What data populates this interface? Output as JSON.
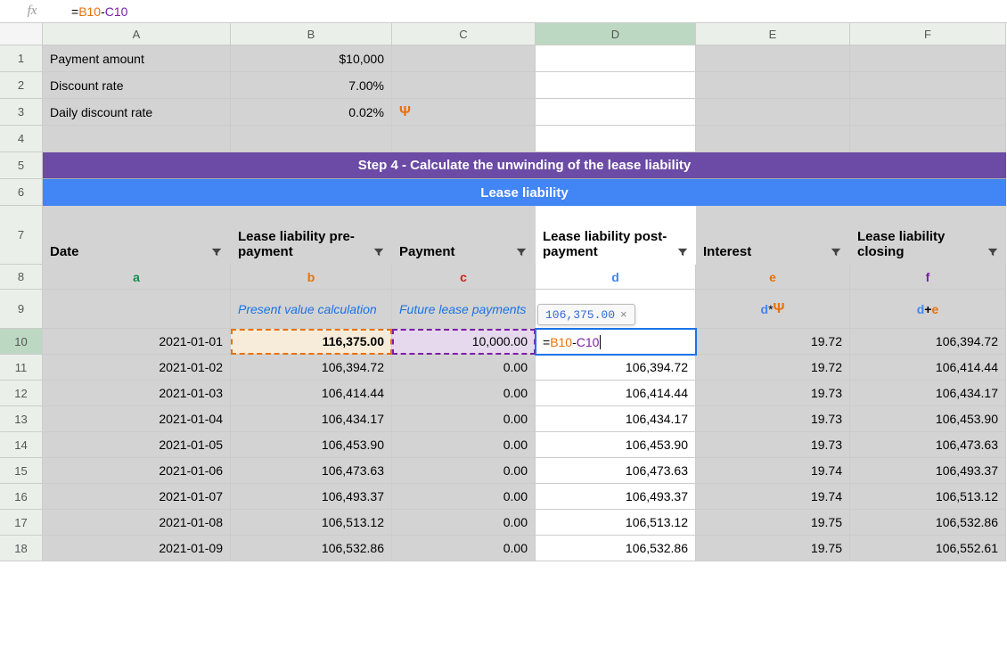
{
  "formula_bar": {
    "fx": "fx",
    "eq": "=",
    "ref_b": "B10",
    "minus": "-",
    "ref_c": "C10"
  },
  "columns": [
    "A",
    "B",
    "C",
    "D",
    "E",
    "F"
  ],
  "row_nums": [
    "1",
    "2",
    "3",
    "4",
    "5",
    "6",
    "7",
    "8",
    "9",
    "10",
    "11",
    "12",
    "13",
    "14",
    "15",
    "16",
    "17",
    "18"
  ],
  "params": {
    "a1": "Payment amount",
    "b1": "$10,000",
    "a2": "Discount rate",
    "b2": "7.00%",
    "a3": "Daily discount rate",
    "b3": "0.02%",
    "c3": "Ψ"
  },
  "titles": {
    "step": "Step 4 - Calculate the unwinding of the lease liability",
    "lease": "Lease liability"
  },
  "headers": {
    "a": "Date",
    "b": "Lease liability pre-payment",
    "c": "Payment",
    "d": "Lease liability post-payment",
    "e": "Interest",
    "f": "Lease liability closing"
  },
  "letters": {
    "a": "a",
    "b": "b",
    "c": "c",
    "d": "d",
    "e": "e",
    "f": "f"
  },
  "row9": {
    "b": "Present value calculation",
    "c": "Future lease payments",
    "e_d": "d",
    "e_star": " * ",
    "e_psi": "Ψ",
    "f_d": "d",
    "f_plus": " + ",
    "f_e": "e"
  },
  "d10_edit": {
    "hint": "106,375.00",
    "hint_x": "×",
    "eq": "=",
    "ref_b": "B10",
    "minus": "-",
    "ref_c": "C10"
  },
  "data": [
    {
      "a": "2021-01-01",
      "b": "116,375.00",
      "c": "10,000.00",
      "d": "",
      "e": "19.72",
      "f": "106,394.72"
    },
    {
      "a": "2021-01-02",
      "b": "106,394.72",
      "c": "0.00",
      "d": "106,394.72",
      "e": "19.72",
      "f": "106,414.44"
    },
    {
      "a": "2021-01-03",
      "b": "106,414.44",
      "c": "0.00",
      "d": "106,414.44",
      "e": "19.73",
      "f": "106,434.17"
    },
    {
      "a": "2021-01-04",
      "b": "106,434.17",
      "c": "0.00",
      "d": "106,434.17",
      "e": "19.73",
      "f": "106,453.90"
    },
    {
      "a": "2021-01-05",
      "b": "106,453.90",
      "c": "0.00",
      "d": "106,453.90",
      "e": "19.73",
      "f": "106,473.63"
    },
    {
      "a": "2021-01-06",
      "b": "106,473.63",
      "c": "0.00",
      "d": "106,473.63",
      "e": "19.74",
      "f": "106,493.37"
    },
    {
      "a": "2021-01-07",
      "b": "106,493.37",
      "c": "0.00",
      "d": "106,493.37",
      "e": "19.74",
      "f": "106,513.12"
    },
    {
      "a": "2021-01-08",
      "b": "106,513.12",
      "c": "0.00",
      "d": "106,513.12",
      "e": "19.75",
      "f": "106,532.86"
    },
    {
      "a": "2021-01-09",
      "b": "106,532.86",
      "c": "0.00",
      "d": "106,532.86",
      "e": "19.75",
      "f": "106,552.61"
    }
  ]
}
